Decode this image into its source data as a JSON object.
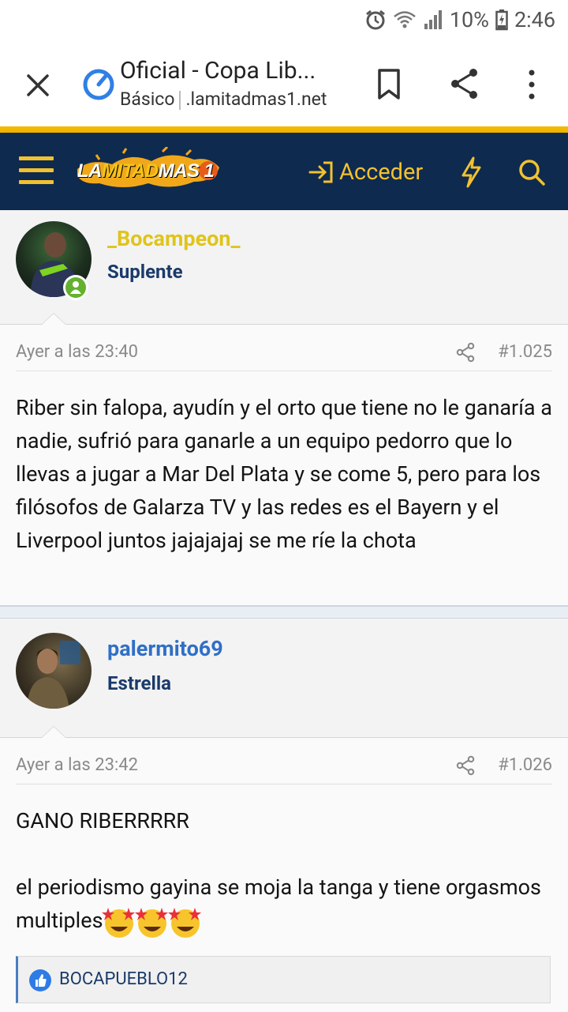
{
  "status_bar": {
    "battery": "10%",
    "time": "2:46"
  },
  "browser": {
    "title": "Oficial - Copa Lib...",
    "mode": "Básico",
    "domain": ".lamitadmas1.net"
  },
  "site_nav": {
    "logo_part1": "LA",
    "logo_part2": "MITAD",
    "logo_part3": "MAS",
    "logo_part4": "1",
    "login_label": "Acceder",
    "colors": {
      "nav_bg": "#0f2a4f",
      "accent": "#f2c12e"
    }
  },
  "posts": [
    {
      "username": "_Bocampeon_",
      "username_color": "#e0c41a",
      "role": "Suplente",
      "date": "Ayer a las 23:40",
      "number": "#1.025",
      "online": true,
      "text": "Riber sin falopa, ayudín y el orto que tiene no le ganaría a nadie, sufrió para ganarle a un equipo pedorro que lo llevas a jugar a Mar Del Plata y se come 5, pero para los filósofos de Galarza TV y las redes es el Bayern y el Liverpool juntos jajajajaj se me ríe la chota"
    },
    {
      "username": "palermito69",
      "username_color": "#2f6fc6",
      "role": "Estrella",
      "date": "Ayer a las 23:42",
      "number": "#1.026",
      "online": false,
      "text_line1": "GANO RIBERRRRR",
      "text_line2": "el periodismo gayina se moja la tanga y tiene orgasmos multiples",
      "likes": "BOCAPUEBLO12"
    }
  ]
}
